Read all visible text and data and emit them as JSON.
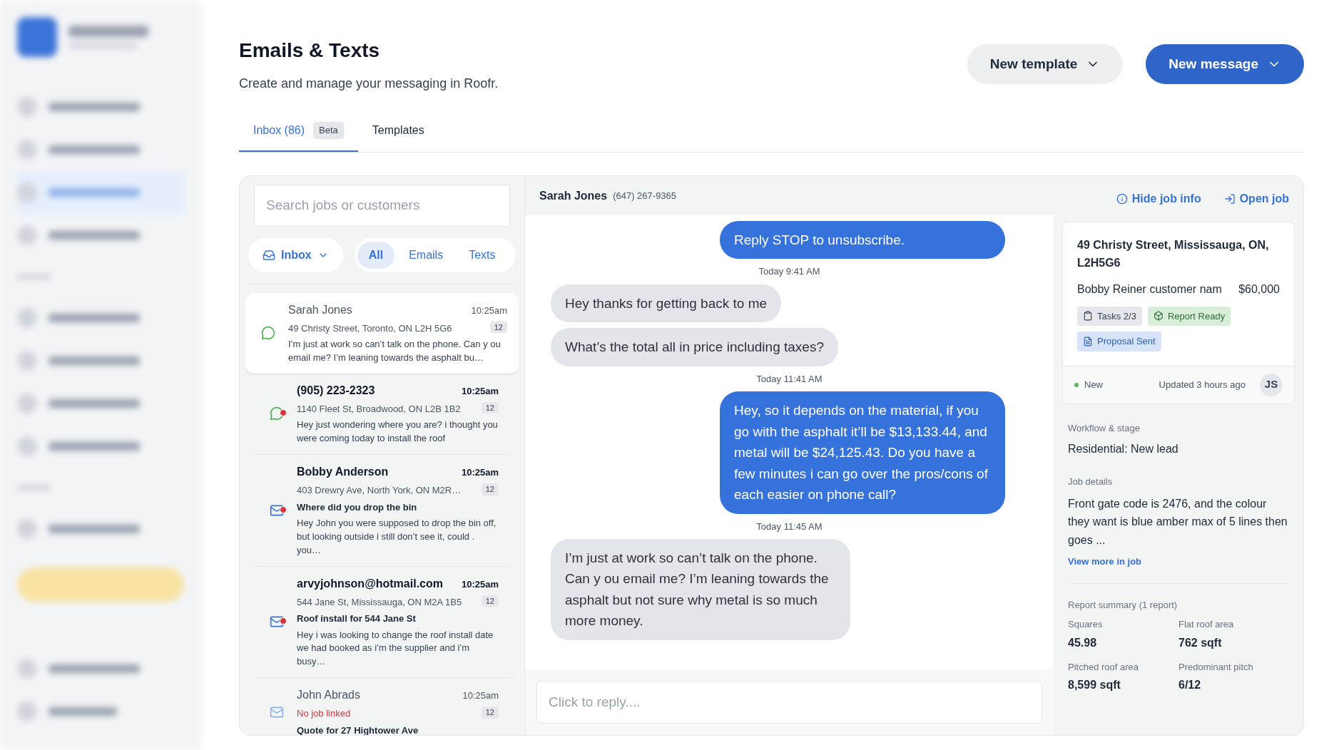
{
  "header": {
    "title": "Emails & Texts",
    "subtitle": "Create and manage your messaging in Roofr.",
    "buttons": [
      {
        "label": "New template",
        "kind": "secondary"
      },
      {
        "label": "New message",
        "kind": "primary"
      }
    ]
  },
  "tabs": [
    {
      "label": "Inbox (86)",
      "badge": "Beta",
      "selected": true
    },
    {
      "label": "Templates",
      "selected": false
    }
  ],
  "search": {
    "placeholder": "Search jobs or customers"
  },
  "folder": {
    "label": "Inbox"
  },
  "filters": [
    {
      "label": "All",
      "selected": true
    },
    {
      "label": "Emails",
      "selected": false
    },
    {
      "label": "Texts",
      "selected": false
    }
  ],
  "conversations": [
    {
      "name": "Sarah Jones",
      "time": "10:25am",
      "count": "12",
      "line": "49 Christy Street, Toronto, ON L2H 5G6",
      "job_linked": true,
      "preview": "I’m just at work so can’t talk on the phone. Can y ou email me? I’m leaning towards the asphalt bu…",
      "kind": "text",
      "unread": false,
      "selected": true
    },
    {
      "name": "(905) 223-2323",
      "time": "10:25am",
      "count": "12",
      "line": "1140 Fleet St, Broadwood, ON L2B 1B2",
      "job_linked": true,
      "preview": "Hey just wondering where you are? i thought you were coming today to install the roof",
      "kind": "text",
      "unread": true,
      "selected": false
    },
    {
      "name": "Bobby Anderson",
      "time": "10:25am",
      "count": "12",
      "line": "403 Drewry Ave, North York, ON M2R…",
      "job_linked": true,
      "subject": "Where did you drop the bin",
      "preview": "Hey John you were supposed to drop the bin off, but looking outside i still don’t see it, could . you…",
      "kind": "email",
      "unread": true,
      "selected": false
    },
    {
      "name": "arvyjohnson@hotmail.com",
      "time": "10:25am",
      "count": "12",
      "line": "544 Jane St, Mississauga, ON M2A 1B5",
      "job_linked": true,
      "subject": "Roof install for 544 Jane St",
      "preview": "Hey i was looking to change the roof install date we had booked as i’m the supplier and i’m busy…",
      "kind": "email",
      "unread": true,
      "selected": false
    },
    {
      "name": "John Abrads",
      "time": "10:25am",
      "count": "12",
      "line": "No job linked",
      "job_linked": false,
      "subject": "Quote for 27 Hightower Ave",
      "kind": "email",
      "unread": false,
      "selected": false
    }
  ],
  "chat": {
    "name": "Sarah Jones",
    "phone": "(647) 267-9365",
    "reply_placeholder": "Click to reply....",
    "messages": [
      {
        "kind": "outgoing",
        "text": "Reply STOP to unsubscribe."
      },
      {
        "kind": "timestamp",
        "text": "Today 9:41 AM"
      },
      {
        "kind": "incoming",
        "text": "Hey thanks for getting back to me"
      },
      {
        "kind": "incoming",
        "text": "What’s the total all in price including taxes?"
      },
      {
        "kind": "timestamp",
        "text": "Today 11:41 AM"
      },
      {
        "kind": "outgoing",
        "text": "Hey, so it depends on the material, if you go with the asphalt it’ll be $13,133.44, and metal will be $24,125.43. Do you have a few minutes i can go over the pros/cons of each easier on phone call?"
      },
      {
        "kind": "timestamp",
        "text": "Today 11:45 AM"
      },
      {
        "kind": "incoming",
        "text": "I’m just at work so can’t talk on the phone. Can y ou email me? I’m leaning towards the asphalt but not sure why metal is so much more money."
      }
    ]
  },
  "job": {
    "links": [
      {
        "label": "Hide job info",
        "kind": "info"
      },
      {
        "label": "Open job",
        "kind": "open"
      }
    ],
    "address": "49 Christy Street, Mississauga, ON, L2H5G6",
    "customer": "Bobby Reiner customer nam",
    "price": "$60,000",
    "tags": [
      {
        "label": "Tasks 2/3",
        "kind": "tasks"
      },
      {
        "label": "Report Ready",
        "kind": "report"
      },
      {
        "label": "Proposal Sent",
        "kind": "proposal"
      }
    ],
    "status": {
      "label": "New",
      "color": "#5cb85c"
    },
    "updated": "Updated 3 hours ago",
    "initials": "JS",
    "workflow": {
      "label": "Workflow & stage",
      "value": "Residential: New lead"
    },
    "details": {
      "label": "Job details",
      "value": "Front gate code is 2476, and the colour they want is blue amber max of 5 lines then goes ...",
      "link": "View more in job"
    },
    "report": {
      "label": "Report summary (1 report)",
      "stats": [
        {
          "label": "Squares",
          "value": "45.98"
        },
        {
          "label": "Flat roof area",
          "value": "762 sqft"
        },
        {
          "label": "Pitched roof area",
          "value": "8,599 sqft"
        },
        {
          "label": "Predominant pitch",
          "value": "6/12"
        }
      ]
    }
  }
}
